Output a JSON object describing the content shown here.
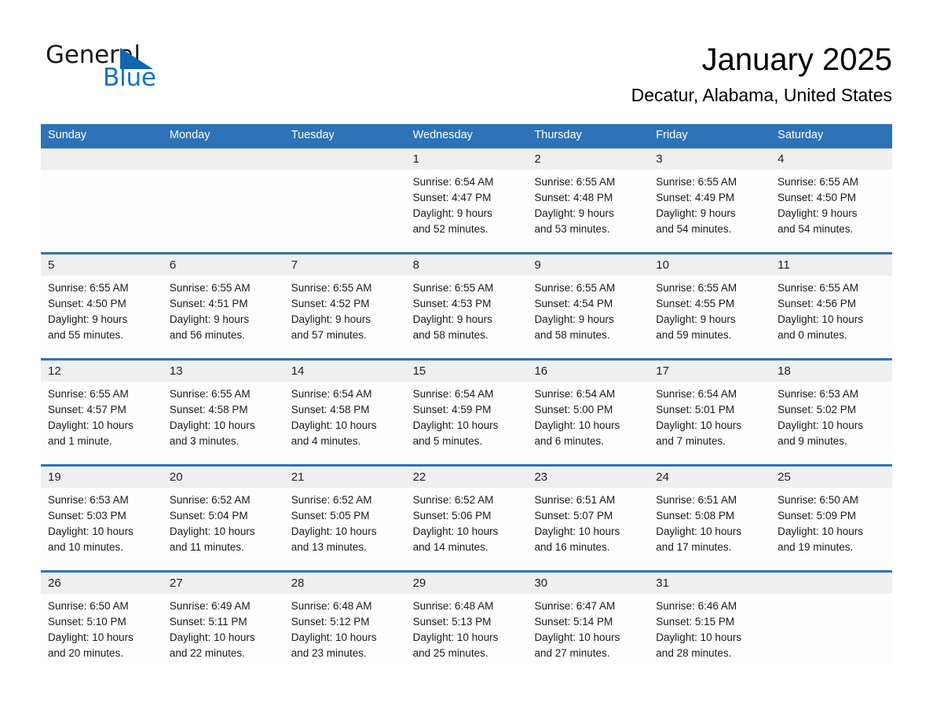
{
  "brand": {
    "name_part1": "General",
    "name_part2": "Blue",
    "logo_icon": "triangle-flag-icon",
    "accent_color": "#1273c4"
  },
  "header": {
    "month_title": "January 2025",
    "location": "Decatur, Alabama, United States"
  },
  "theme": {
    "header_blue": "#2E72B8",
    "daynum_band": "#efefef",
    "cell_background": "#fdfdfd",
    "text_color": "#1a1a1a"
  },
  "weekdays": [
    "Sunday",
    "Monday",
    "Tuesday",
    "Wednesday",
    "Thursday",
    "Friday",
    "Saturday"
  ],
  "weeks": [
    [
      {
        "day": "",
        "empty": true
      },
      {
        "day": "",
        "empty": true
      },
      {
        "day": "",
        "empty": true
      },
      {
        "day": "1",
        "sunrise": "Sunrise: 6:54 AM",
        "sunset": "Sunset: 4:47 PM",
        "daylight_line1": "Daylight: 9 hours",
        "daylight_line2": "and 52 minutes."
      },
      {
        "day": "2",
        "sunrise": "Sunrise: 6:55 AM",
        "sunset": "Sunset: 4:48 PM",
        "daylight_line1": "Daylight: 9 hours",
        "daylight_line2": "and 53 minutes."
      },
      {
        "day": "3",
        "sunrise": "Sunrise: 6:55 AM",
        "sunset": "Sunset: 4:49 PM",
        "daylight_line1": "Daylight: 9 hours",
        "daylight_line2": "and 54 minutes."
      },
      {
        "day": "4",
        "sunrise": "Sunrise: 6:55 AM",
        "sunset": "Sunset: 4:50 PM",
        "daylight_line1": "Daylight: 9 hours",
        "daylight_line2": "and 54 minutes."
      }
    ],
    [
      {
        "day": "5",
        "sunrise": "Sunrise: 6:55 AM",
        "sunset": "Sunset: 4:50 PM",
        "daylight_line1": "Daylight: 9 hours",
        "daylight_line2": "and 55 minutes."
      },
      {
        "day": "6",
        "sunrise": "Sunrise: 6:55 AM",
        "sunset": "Sunset: 4:51 PM",
        "daylight_line1": "Daylight: 9 hours",
        "daylight_line2": "and 56 minutes."
      },
      {
        "day": "7",
        "sunrise": "Sunrise: 6:55 AM",
        "sunset": "Sunset: 4:52 PM",
        "daylight_line1": "Daylight: 9 hours",
        "daylight_line2": "and 57 minutes."
      },
      {
        "day": "8",
        "sunrise": "Sunrise: 6:55 AM",
        "sunset": "Sunset: 4:53 PM",
        "daylight_line1": "Daylight: 9 hours",
        "daylight_line2": "and 58 minutes."
      },
      {
        "day": "9",
        "sunrise": "Sunrise: 6:55 AM",
        "sunset": "Sunset: 4:54 PM",
        "daylight_line1": "Daylight: 9 hours",
        "daylight_line2": "and 58 minutes."
      },
      {
        "day": "10",
        "sunrise": "Sunrise: 6:55 AM",
        "sunset": "Sunset: 4:55 PM",
        "daylight_line1": "Daylight: 9 hours",
        "daylight_line2": "and 59 minutes."
      },
      {
        "day": "11",
        "sunrise": "Sunrise: 6:55 AM",
        "sunset": "Sunset: 4:56 PM",
        "daylight_line1": "Daylight: 10 hours",
        "daylight_line2": "and 0 minutes."
      }
    ],
    [
      {
        "day": "12",
        "sunrise": "Sunrise: 6:55 AM",
        "sunset": "Sunset: 4:57 PM",
        "daylight_line1": "Daylight: 10 hours",
        "daylight_line2": "and 1 minute."
      },
      {
        "day": "13",
        "sunrise": "Sunrise: 6:55 AM",
        "sunset": "Sunset: 4:58 PM",
        "daylight_line1": "Daylight: 10 hours",
        "daylight_line2": "and 3 minutes."
      },
      {
        "day": "14",
        "sunrise": "Sunrise: 6:54 AM",
        "sunset": "Sunset: 4:58 PM",
        "daylight_line1": "Daylight: 10 hours",
        "daylight_line2": "and 4 minutes."
      },
      {
        "day": "15",
        "sunrise": "Sunrise: 6:54 AM",
        "sunset": "Sunset: 4:59 PM",
        "daylight_line1": "Daylight: 10 hours",
        "daylight_line2": "and 5 minutes."
      },
      {
        "day": "16",
        "sunrise": "Sunrise: 6:54 AM",
        "sunset": "Sunset: 5:00 PM",
        "daylight_line1": "Daylight: 10 hours",
        "daylight_line2": "and 6 minutes."
      },
      {
        "day": "17",
        "sunrise": "Sunrise: 6:54 AM",
        "sunset": "Sunset: 5:01 PM",
        "daylight_line1": "Daylight: 10 hours",
        "daylight_line2": "and 7 minutes."
      },
      {
        "day": "18",
        "sunrise": "Sunrise: 6:53 AM",
        "sunset": "Sunset: 5:02 PM",
        "daylight_line1": "Daylight: 10 hours",
        "daylight_line2": "and 9 minutes."
      }
    ],
    [
      {
        "day": "19",
        "sunrise": "Sunrise: 6:53 AM",
        "sunset": "Sunset: 5:03 PM",
        "daylight_line1": "Daylight: 10 hours",
        "daylight_line2": "and 10 minutes."
      },
      {
        "day": "20",
        "sunrise": "Sunrise: 6:52 AM",
        "sunset": "Sunset: 5:04 PM",
        "daylight_line1": "Daylight: 10 hours",
        "daylight_line2": "and 11 minutes."
      },
      {
        "day": "21",
        "sunrise": "Sunrise: 6:52 AM",
        "sunset": "Sunset: 5:05 PM",
        "daylight_line1": "Daylight: 10 hours",
        "daylight_line2": "and 13 minutes."
      },
      {
        "day": "22",
        "sunrise": "Sunrise: 6:52 AM",
        "sunset": "Sunset: 5:06 PM",
        "daylight_line1": "Daylight: 10 hours",
        "daylight_line2": "and 14 minutes."
      },
      {
        "day": "23",
        "sunrise": "Sunrise: 6:51 AM",
        "sunset": "Sunset: 5:07 PM",
        "daylight_line1": "Daylight: 10 hours",
        "daylight_line2": "and 16 minutes."
      },
      {
        "day": "24",
        "sunrise": "Sunrise: 6:51 AM",
        "sunset": "Sunset: 5:08 PM",
        "daylight_line1": "Daylight: 10 hours",
        "daylight_line2": "and 17 minutes."
      },
      {
        "day": "25",
        "sunrise": "Sunrise: 6:50 AM",
        "sunset": "Sunset: 5:09 PM",
        "daylight_line1": "Daylight: 10 hours",
        "daylight_line2": "and 19 minutes."
      }
    ],
    [
      {
        "day": "26",
        "sunrise": "Sunrise: 6:50 AM",
        "sunset": "Sunset: 5:10 PM",
        "daylight_line1": "Daylight: 10 hours",
        "daylight_line2": "and 20 minutes."
      },
      {
        "day": "27",
        "sunrise": "Sunrise: 6:49 AM",
        "sunset": "Sunset: 5:11 PM",
        "daylight_line1": "Daylight: 10 hours",
        "daylight_line2": "and 22 minutes."
      },
      {
        "day": "28",
        "sunrise": "Sunrise: 6:48 AM",
        "sunset": "Sunset: 5:12 PM",
        "daylight_line1": "Daylight: 10 hours",
        "daylight_line2": "and 23 minutes."
      },
      {
        "day": "29",
        "sunrise": "Sunrise: 6:48 AM",
        "sunset": "Sunset: 5:13 PM",
        "daylight_line1": "Daylight: 10 hours",
        "daylight_line2": "and 25 minutes."
      },
      {
        "day": "30",
        "sunrise": "Sunrise: 6:47 AM",
        "sunset": "Sunset: 5:14 PM",
        "daylight_line1": "Daylight: 10 hours",
        "daylight_line2": "and 27 minutes."
      },
      {
        "day": "31",
        "sunrise": "Sunrise: 6:46 AM",
        "sunset": "Sunset: 5:15 PM",
        "daylight_line1": "Daylight: 10 hours",
        "daylight_line2": "and 28 minutes."
      },
      {
        "day": "",
        "empty": true
      }
    ]
  ]
}
